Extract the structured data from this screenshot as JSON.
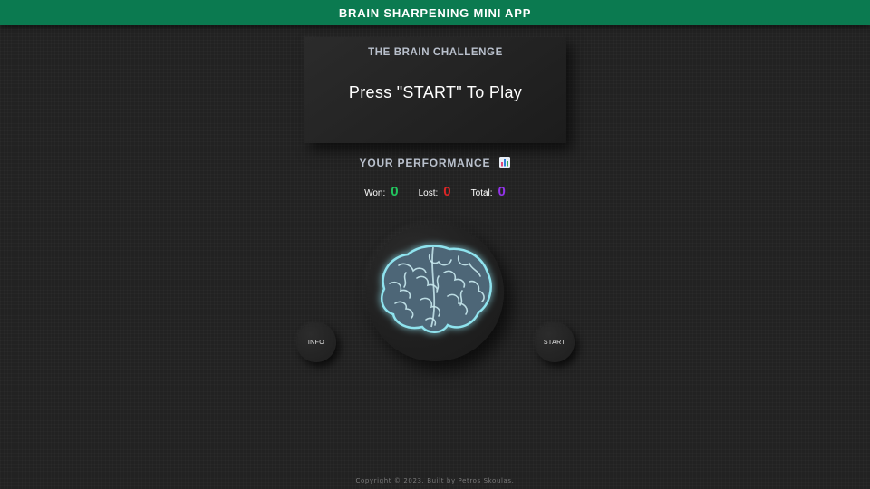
{
  "app": {
    "title": "BRAIN SHARPENING MINI APP"
  },
  "challenge": {
    "heading": "THE BRAIN CHALLENGE",
    "prompt": "Press \"START\" To Play"
  },
  "performance": {
    "heading": "YOUR PERFORMANCE",
    "icon": "bar-chart-icon",
    "won_label": "Won:",
    "won_value": "0",
    "lost_label": "Lost:",
    "lost_value": "0",
    "total_label": "Total:",
    "total_value": "0"
  },
  "controls": {
    "info_label": "INFO",
    "start_label": "START"
  },
  "brain": {
    "icon": "brain-icon"
  },
  "footer": {
    "text": "Copyright © 2023. Built by Petros Skoulas."
  },
  "colors": {
    "topbar": "#0b7a50",
    "background": "#222222",
    "won": "#22c55e",
    "lost": "#dc2626",
    "total": "#9333ea",
    "brain_glow": "#5ec6d6"
  }
}
